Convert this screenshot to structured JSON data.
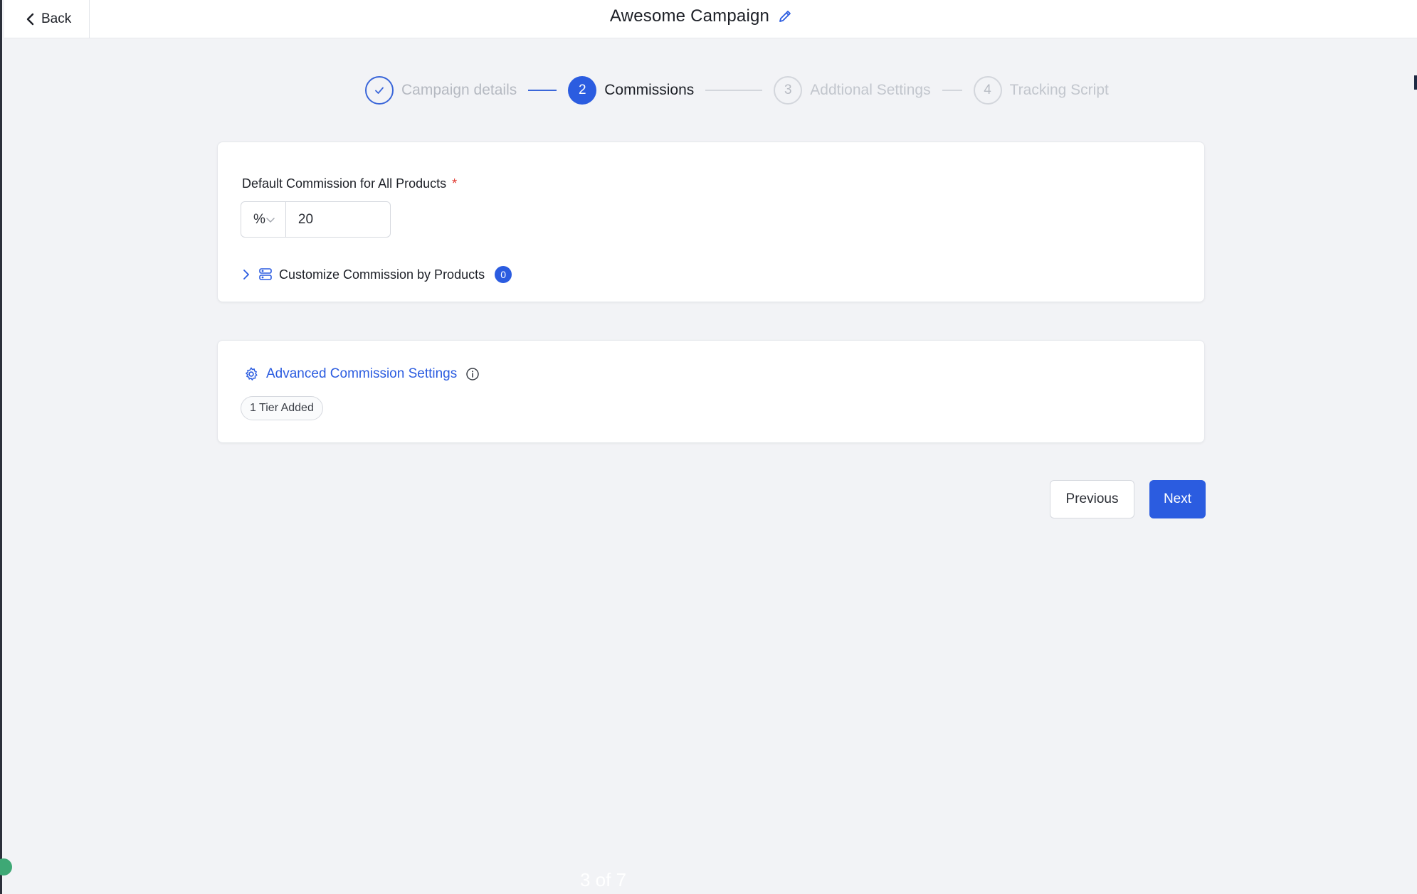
{
  "header": {
    "back_label": "Back",
    "title": "Awesome Campaign"
  },
  "stepper": {
    "steps": [
      {
        "number": "✓",
        "label": "Campaign details",
        "state": "done"
      },
      {
        "number": "2",
        "label": "Commissions",
        "state": "active"
      },
      {
        "number": "3",
        "label": "Addtional Settings",
        "state": "todo"
      },
      {
        "number": "4",
        "label": "Tracking Script",
        "state": "todo"
      }
    ]
  },
  "default_commission": {
    "label": "Default Commission for All Products",
    "required_mark": "*",
    "unit_selected": "%",
    "value": "20",
    "customize_label": "Customize Commission by Products",
    "customize_count": "0"
  },
  "advanced": {
    "label": "Advanced Commission Settings",
    "tier_pill": "1 Tier Added"
  },
  "footer": {
    "previous_label": "Previous",
    "next_label": "Next",
    "pager": "3 of 7"
  },
  "colors": {
    "accent": "#2b5ce0",
    "background": "#f2f3f6",
    "required": "#e0342b"
  }
}
